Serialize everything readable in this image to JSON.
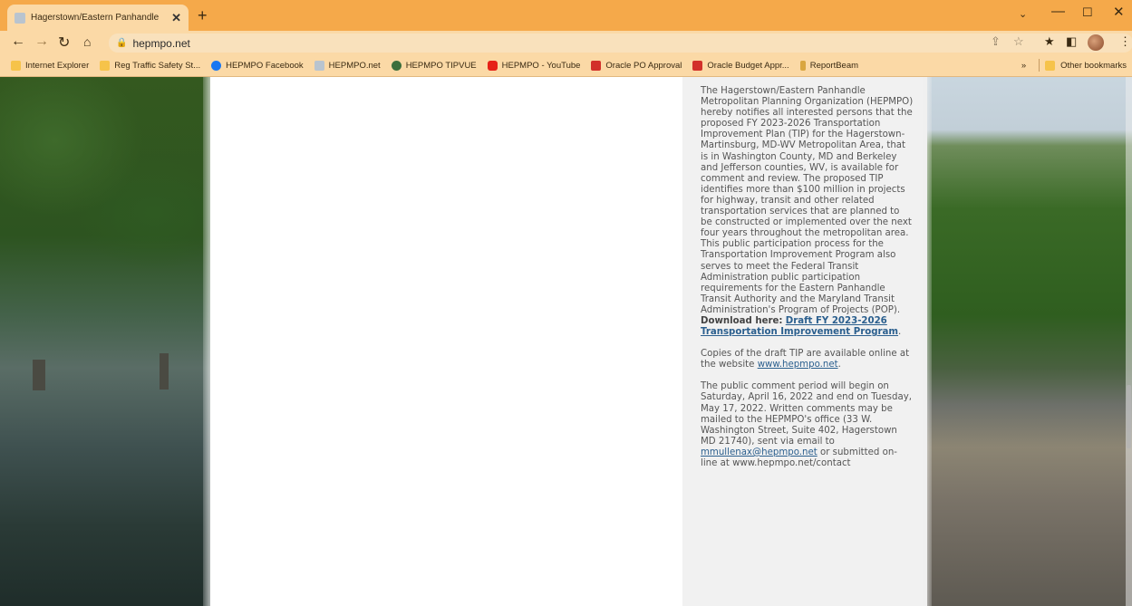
{
  "browser": {
    "tab_title": "Hagerstown/Eastern Panhandle",
    "new_tab_glyph": "+",
    "url": "hepmpo.net",
    "bookmarks": [
      {
        "label": "Internet Explorer",
        "icon": "folder-icon",
        "color": "#f6c34a"
      },
      {
        "label": "Reg Traffic Safety St...",
        "icon": "folder-icon",
        "color": "#f6c34a"
      },
      {
        "label": "HEPMPO Facebook",
        "icon": "facebook-icon",
        "color": "#1877f2"
      },
      {
        "label": "HEPMPO.net",
        "icon": "site-icon",
        "color": "#b9c4cf"
      },
      {
        "label": "HEPMPO TIPVUE",
        "icon": "globe-icon",
        "color": "#3c6e3c"
      },
      {
        "label": "HEPMPO - YouTube",
        "icon": "youtube-icon",
        "color": "#e62117"
      },
      {
        "label": "Oracle PO Approval",
        "icon": "oracle-icon",
        "color": "#d2302a"
      },
      {
        "label": "Oracle Budget Appr...",
        "icon": "oracle-icon",
        "color": "#d2302a"
      },
      {
        "label": "ReportBeam",
        "icon": "reportbeam-icon",
        "color": "#d9a640"
      }
    ],
    "other_bookmarks": "Other bookmarks"
  },
  "article": {
    "p1_text": "The Hagerstown/Eastern Panhandle Metropolitan Planning Organization (HEPMPO) hereby notifies all interested persons that the proposed FY 2023-2026 Transportation Improvement Plan (TIP) for the Hagerstown-Martinsburg, MD-WV Metropolitan Area, that is in Washington County, MD and Berkeley and Jefferson counties, WV, is available for comment and review.  The proposed TIP identifies more than $100 million in projects for highway, transit and other related transportation services that are planned to be constructed or implemented over the next four years throughout the metropolitan area.  This public participation process for the Transportation Improvement Program also serves to meet the Federal Transit Administration public participation requirements for the Eastern Panhandle Transit Authority and the Maryland Transit Administration's Program of Projects (POP).",
    "download_label": "Download here:",
    "download_link": "Draft FY 2023-2026 Transportation Improvement Program",
    "period_after_link": ".",
    "p2_text": "Copies of the draft TIP are available online at the website",
    "p2_link": "www.hepmpo.net",
    "p3_text": "The public comment period will begin on Saturday, April 16, 2022 and end on Tuesday, May 17, 2022.  Written comments may be mailed to the HEPMPO's office (33 W. Washington Street, Suite 402, Hagerstown MD 21740), sent via email to",
    "p3_email": "mmullenax@hepmpo.net",
    "p3_tail": "or submitted on-line at www.hepmpo.net/contact"
  }
}
